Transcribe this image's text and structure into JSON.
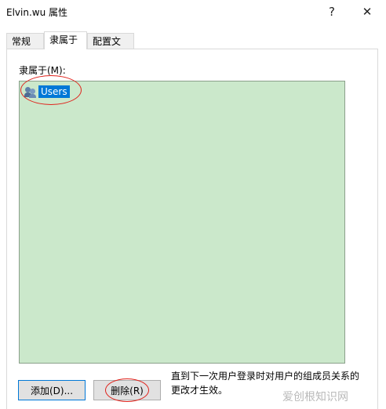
{
  "window": {
    "title": "Elvin.wu 属性",
    "help_glyph": "?",
    "close_glyph": "✕"
  },
  "tabs": [
    {
      "label": "常规",
      "active": false
    },
    {
      "label": "隶属于",
      "active": true
    },
    {
      "label": "配置文件",
      "active": false
    }
  ],
  "member_of": {
    "label": "隶属于(M):",
    "items": [
      {
        "name": "Users",
        "icon": "group-icon",
        "selected": true
      }
    ],
    "list_bg": "#cbe8cb"
  },
  "buttons": {
    "add": "添加(D)...",
    "remove": "删除(R)"
  },
  "note": "直到下一次用户登录时对用户的组成员关系的更改才生效。",
  "watermark": "爱创根知识网",
  "colors": {
    "selection": "#0078d7",
    "annotation": "#e0221b",
    "focus_border": "#0078d7"
  }
}
